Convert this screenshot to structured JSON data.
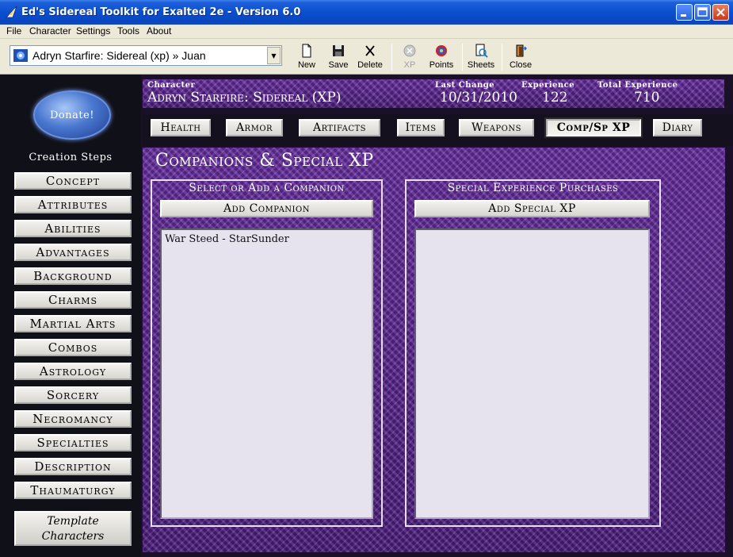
{
  "window": {
    "title": "Ed's Sidereal Toolkit for Exalted 2e - Version 6.0"
  },
  "menu": [
    "File",
    "Character",
    "Settings",
    "Tools",
    "About"
  ],
  "toolbar": {
    "character_select": "Adryn Starfire: Sidereal (xp) » Juan",
    "buttons": {
      "new": "New",
      "save": "Save",
      "delete": "Delete",
      "xp": "XP",
      "points": "Points",
      "sheets": "Sheets",
      "close": "Close"
    }
  },
  "sidebar": {
    "donate": "Donate!",
    "heading": "Creation Steps",
    "steps": [
      "Concept",
      "Attributes",
      "Abilities",
      "Advantages",
      "Background",
      "Charms",
      "Martial Arts",
      "Combos",
      "Astrology",
      "Sorcery",
      "Necromancy",
      "Specialties",
      "Description",
      "Thaumaturgy"
    ],
    "template_line1": "Template",
    "template_line2": "Characters"
  },
  "header": {
    "character_label": "Character",
    "character_value": "Adryn Starfire: Sidereal (XP)",
    "last_change_label": "Last Change",
    "last_change_value": "10/31/2010",
    "experience_label": "Experience",
    "experience_value": "122",
    "total_experience_label": "Total Experience",
    "total_experience_value": "710"
  },
  "tabs": [
    "Health",
    "Armor",
    "Artifacts",
    "Items",
    "Weapons",
    "Comp/Sp XP",
    "Diary"
  ],
  "active_tab": "Comp/Sp XP",
  "content": {
    "title": "Companions & Special XP",
    "companions": {
      "heading": "Select or Add a Companion",
      "add_button": "Add Companion",
      "items": [
        "War Steed - StarSunder"
      ]
    },
    "special_xp": {
      "heading": "Special Experience Purchases",
      "add_button": "Add Special XP",
      "items": []
    }
  }
}
